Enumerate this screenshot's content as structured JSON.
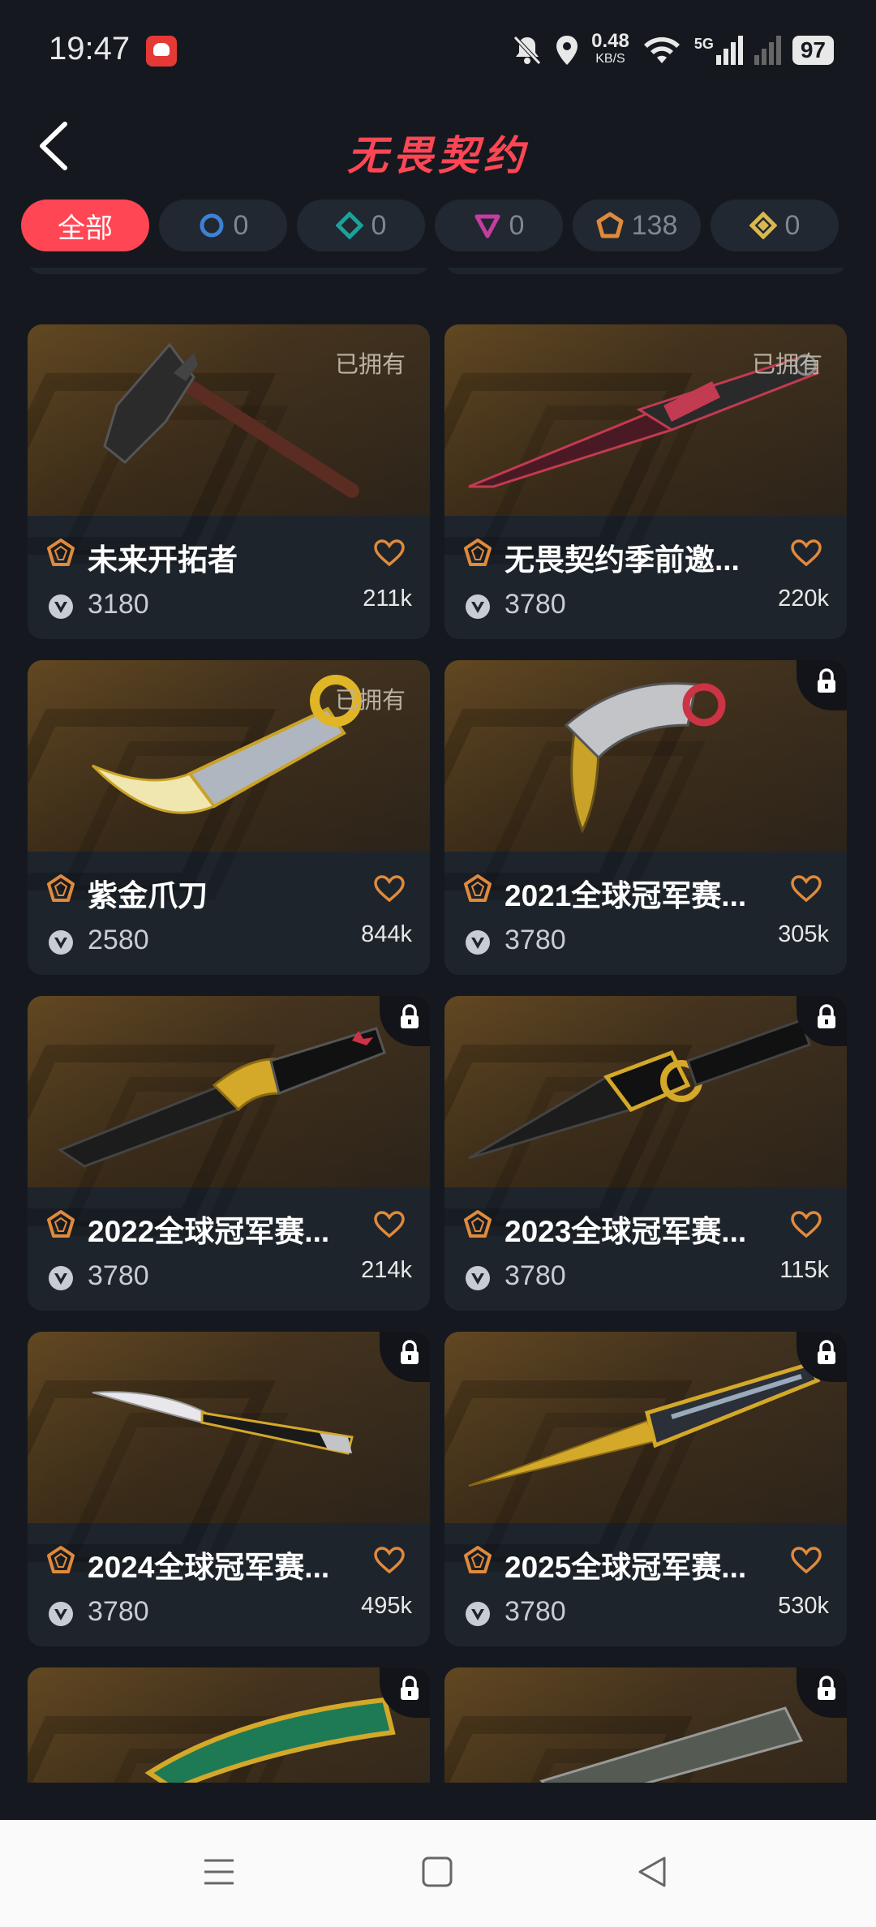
{
  "status": {
    "time": "19:47",
    "speed": "0.48",
    "speed_unit": "KB/S",
    "network": "5G",
    "battery": "97"
  },
  "header": {
    "title": "无畏契约"
  },
  "filters": [
    {
      "label": "全部",
      "active": true
    },
    {
      "count": "0",
      "color": "#3b82d6",
      "shape": "circle"
    },
    {
      "count": "0",
      "color": "#1aa39a",
      "shape": "diamond"
    },
    {
      "count": "0",
      "color": "#c43da0",
      "shape": "triangle"
    },
    {
      "count": "138",
      "color": "#e08a3c",
      "shape": "pentagon"
    },
    {
      "count": "0",
      "color": "#d9b84c",
      "shape": "rhombus"
    }
  ],
  "owned_label": "已拥有",
  "cards": [
    {
      "name": "未来开拓者",
      "price": "3180",
      "likes": "211k",
      "owned": true
    },
    {
      "name": "无畏契约季前邀...",
      "price": "3780",
      "likes": "220k",
      "owned": true
    },
    {
      "name": "紫金爪刀",
      "price": "2580",
      "likes": "844k",
      "owned": true
    },
    {
      "name": "2021全球冠军赛...",
      "price": "3780",
      "likes": "305k",
      "owned": false
    },
    {
      "name": "2022全球冠军赛...",
      "price": "3780",
      "likes": "214k",
      "owned": false
    },
    {
      "name": "2023全球冠军赛...",
      "price": "3780",
      "likes": "115k",
      "owned": false
    },
    {
      "name": "2024全球冠军赛...",
      "price": "3780",
      "likes": "495k",
      "owned": false
    },
    {
      "name": "2025全球冠军赛...",
      "price": "3780",
      "likes": "530k",
      "owned": false
    }
  ],
  "colors": {
    "accent": "#ff4655",
    "tier": "#e08a3c",
    "background": "#15191f",
    "card": "#1e242b"
  }
}
